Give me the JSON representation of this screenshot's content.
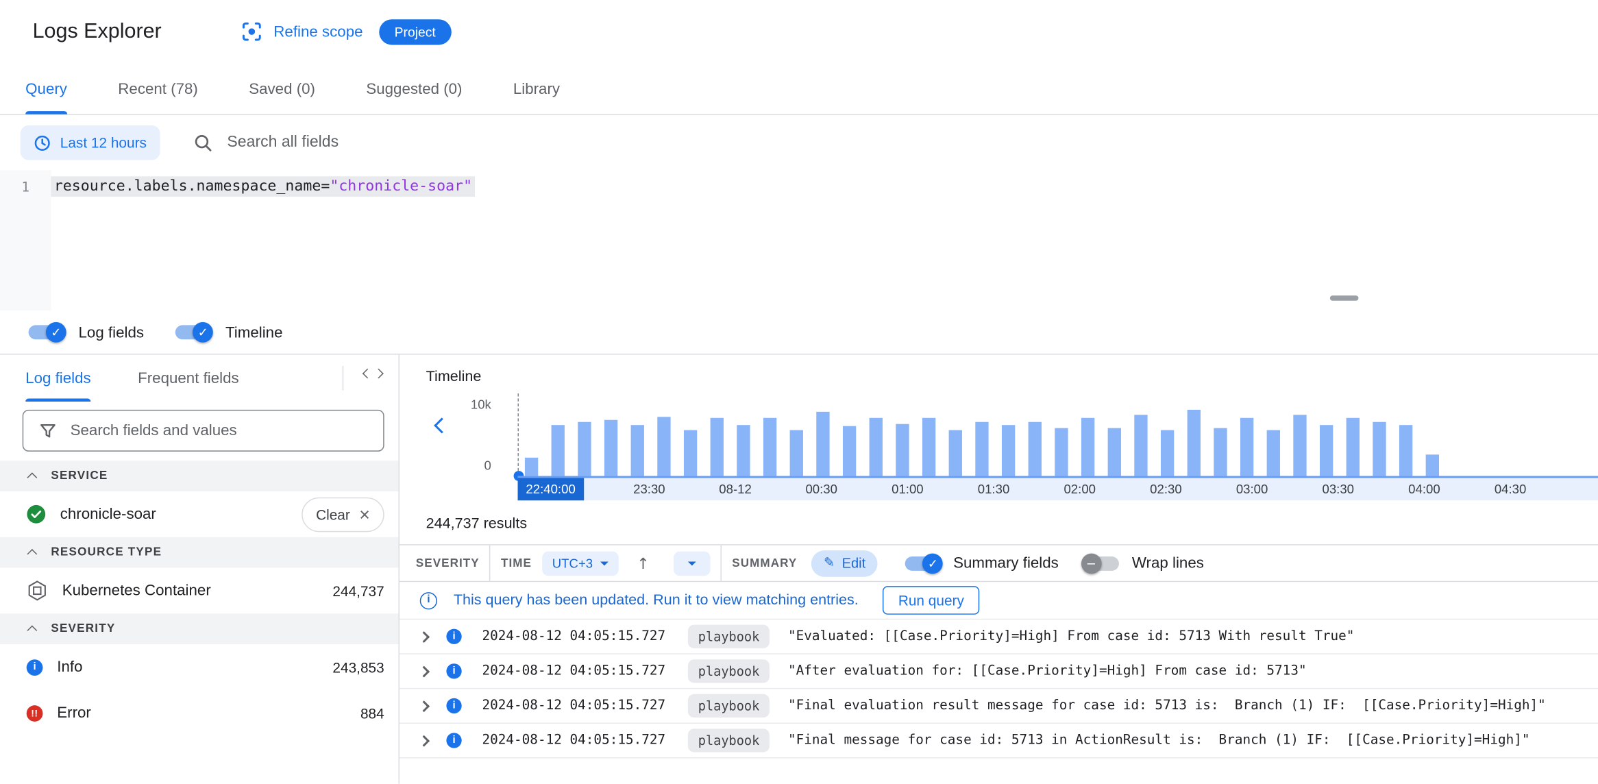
{
  "header": {
    "title": "Logs Explorer",
    "refine_scope_label": "Refine scope",
    "project_badge": "Project"
  },
  "tabs": [
    {
      "label": "Query",
      "active": true
    },
    {
      "label": "Recent (78)",
      "active": false
    },
    {
      "label": "Saved (0)",
      "active": false
    },
    {
      "label": "Suggested (0)",
      "active": false
    },
    {
      "label": "Library",
      "active": false
    }
  ],
  "querybar": {
    "time_range_label": "Last 12 hours",
    "search_placeholder": "Search all fields"
  },
  "editor": {
    "line_number": "1",
    "query_field": "resource.labels.namespace_name",
    "query_operator": "=",
    "query_value": "\"chronicle-soar\""
  },
  "panel_toggles": {
    "log_fields_label": "Log fields",
    "timeline_label": "Timeline"
  },
  "sidebar": {
    "tabs": [
      {
        "label": "Log fields",
        "active": true
      },
      {
        "label": "Frequent fields",
        "active": false
      }
    ],
    "search_placeholder": "Search fields and values",
    "sections": [
      {
        "title": "SERVICE",
        "items": [
          {
            "icon": "check-circle",
            "label": "chronicle-soar",
            "action_label": "Clear"
          }
        ]
      },
      {
        "title": "RESOURCE TYPE",
        "items": [
          {
            "icon": "kubernetes-container",
            "label": "Kubernetes Container",
            "count": "244,737"
          }
        ]
      },
      {
        "title": "SEVERITY",
        "items": [
          {
            "icon": "info",
            "label": "Info",
            "count": "243,853"
          },
          {
            "icon": "error",
            "label": "Error",
            "count": "884"
          }
        ]
      }
    ]
  },
  "timeline": {
    "title": "Timeline",
    "y_axis_max": "10k",
    "y_axis_min": "0",
    "selected_time": "22:40:00",
    "ticks": [
      "23:30",
      "08-12",
      "00:30",
      "01:00",
      "01:30",
      "02:00",
      "02:30",
      "03:00",
      "03:30",
      "04:00",
      "04:30"
    ],
    "bars": [
      22,
      62,
      66,
      68,
      62,
      72,
      56,
      70,
      62,
      70,
      55,
      78,
      60,
      70,
      63,
      70,
      56,
      65,
      62,
      66,
      58,
      70,
      58,
      74,
      55,
      80,
      58,
      70,
      56,
      74,
      62,
      70,
      66,
      62,
      26
    ],
    "bar_color": "#8ab4f8",
    "accent_color": "#1a73e8"
  },
  "results": {
    "count_text": "244,737 results",
    "header": {
      "severity_label": "SEVERITY",
      "time_label": "TIME",
      "timezone_chip": "UTC+3",
      "summary_label": "SUMMARY",
      "edit_button": "Edit",
      "summary_fields_label": "Summary fields",
      "wrap_lines_label": "Wrap lines"
    },
    "banner": {
      "message": "This query has been updated. Run it to view matching entries.",
      "run_button": "Run query"
    },
    "rows": [
      {
        "time": "2024-08-12 04:05:15.727",
        "label_chip": "playbook",
        "message": "\"Evaluated: [[Case.Priority]=High] From case id: 5713 With result True\""
      },
      {
        "time": "2024-08-12 04:05:15.727",
        "label_chip": "playbook",
        "message": "\"After evaluation for: [[Case.Priority]=High] From case id: 5713\""
      },
      {
        "time": "2024-08-12 04:05:15.727",
        "label_chip": "playbook",
        "message": "\"Final evaluation result message for case id: 5713 is:  Branch (1) IF:  [[Case.Priority]=High]\""
      },
      {
        "time": "2024-08-12 04:05:15.727",
        "label_chip": "playbook",
        "message": "\"Final message for case id: 5713 in ActionResult is:  Branch (1) IF:  [[Case.Priority]=High]\""
      }
    ]
  }
}
